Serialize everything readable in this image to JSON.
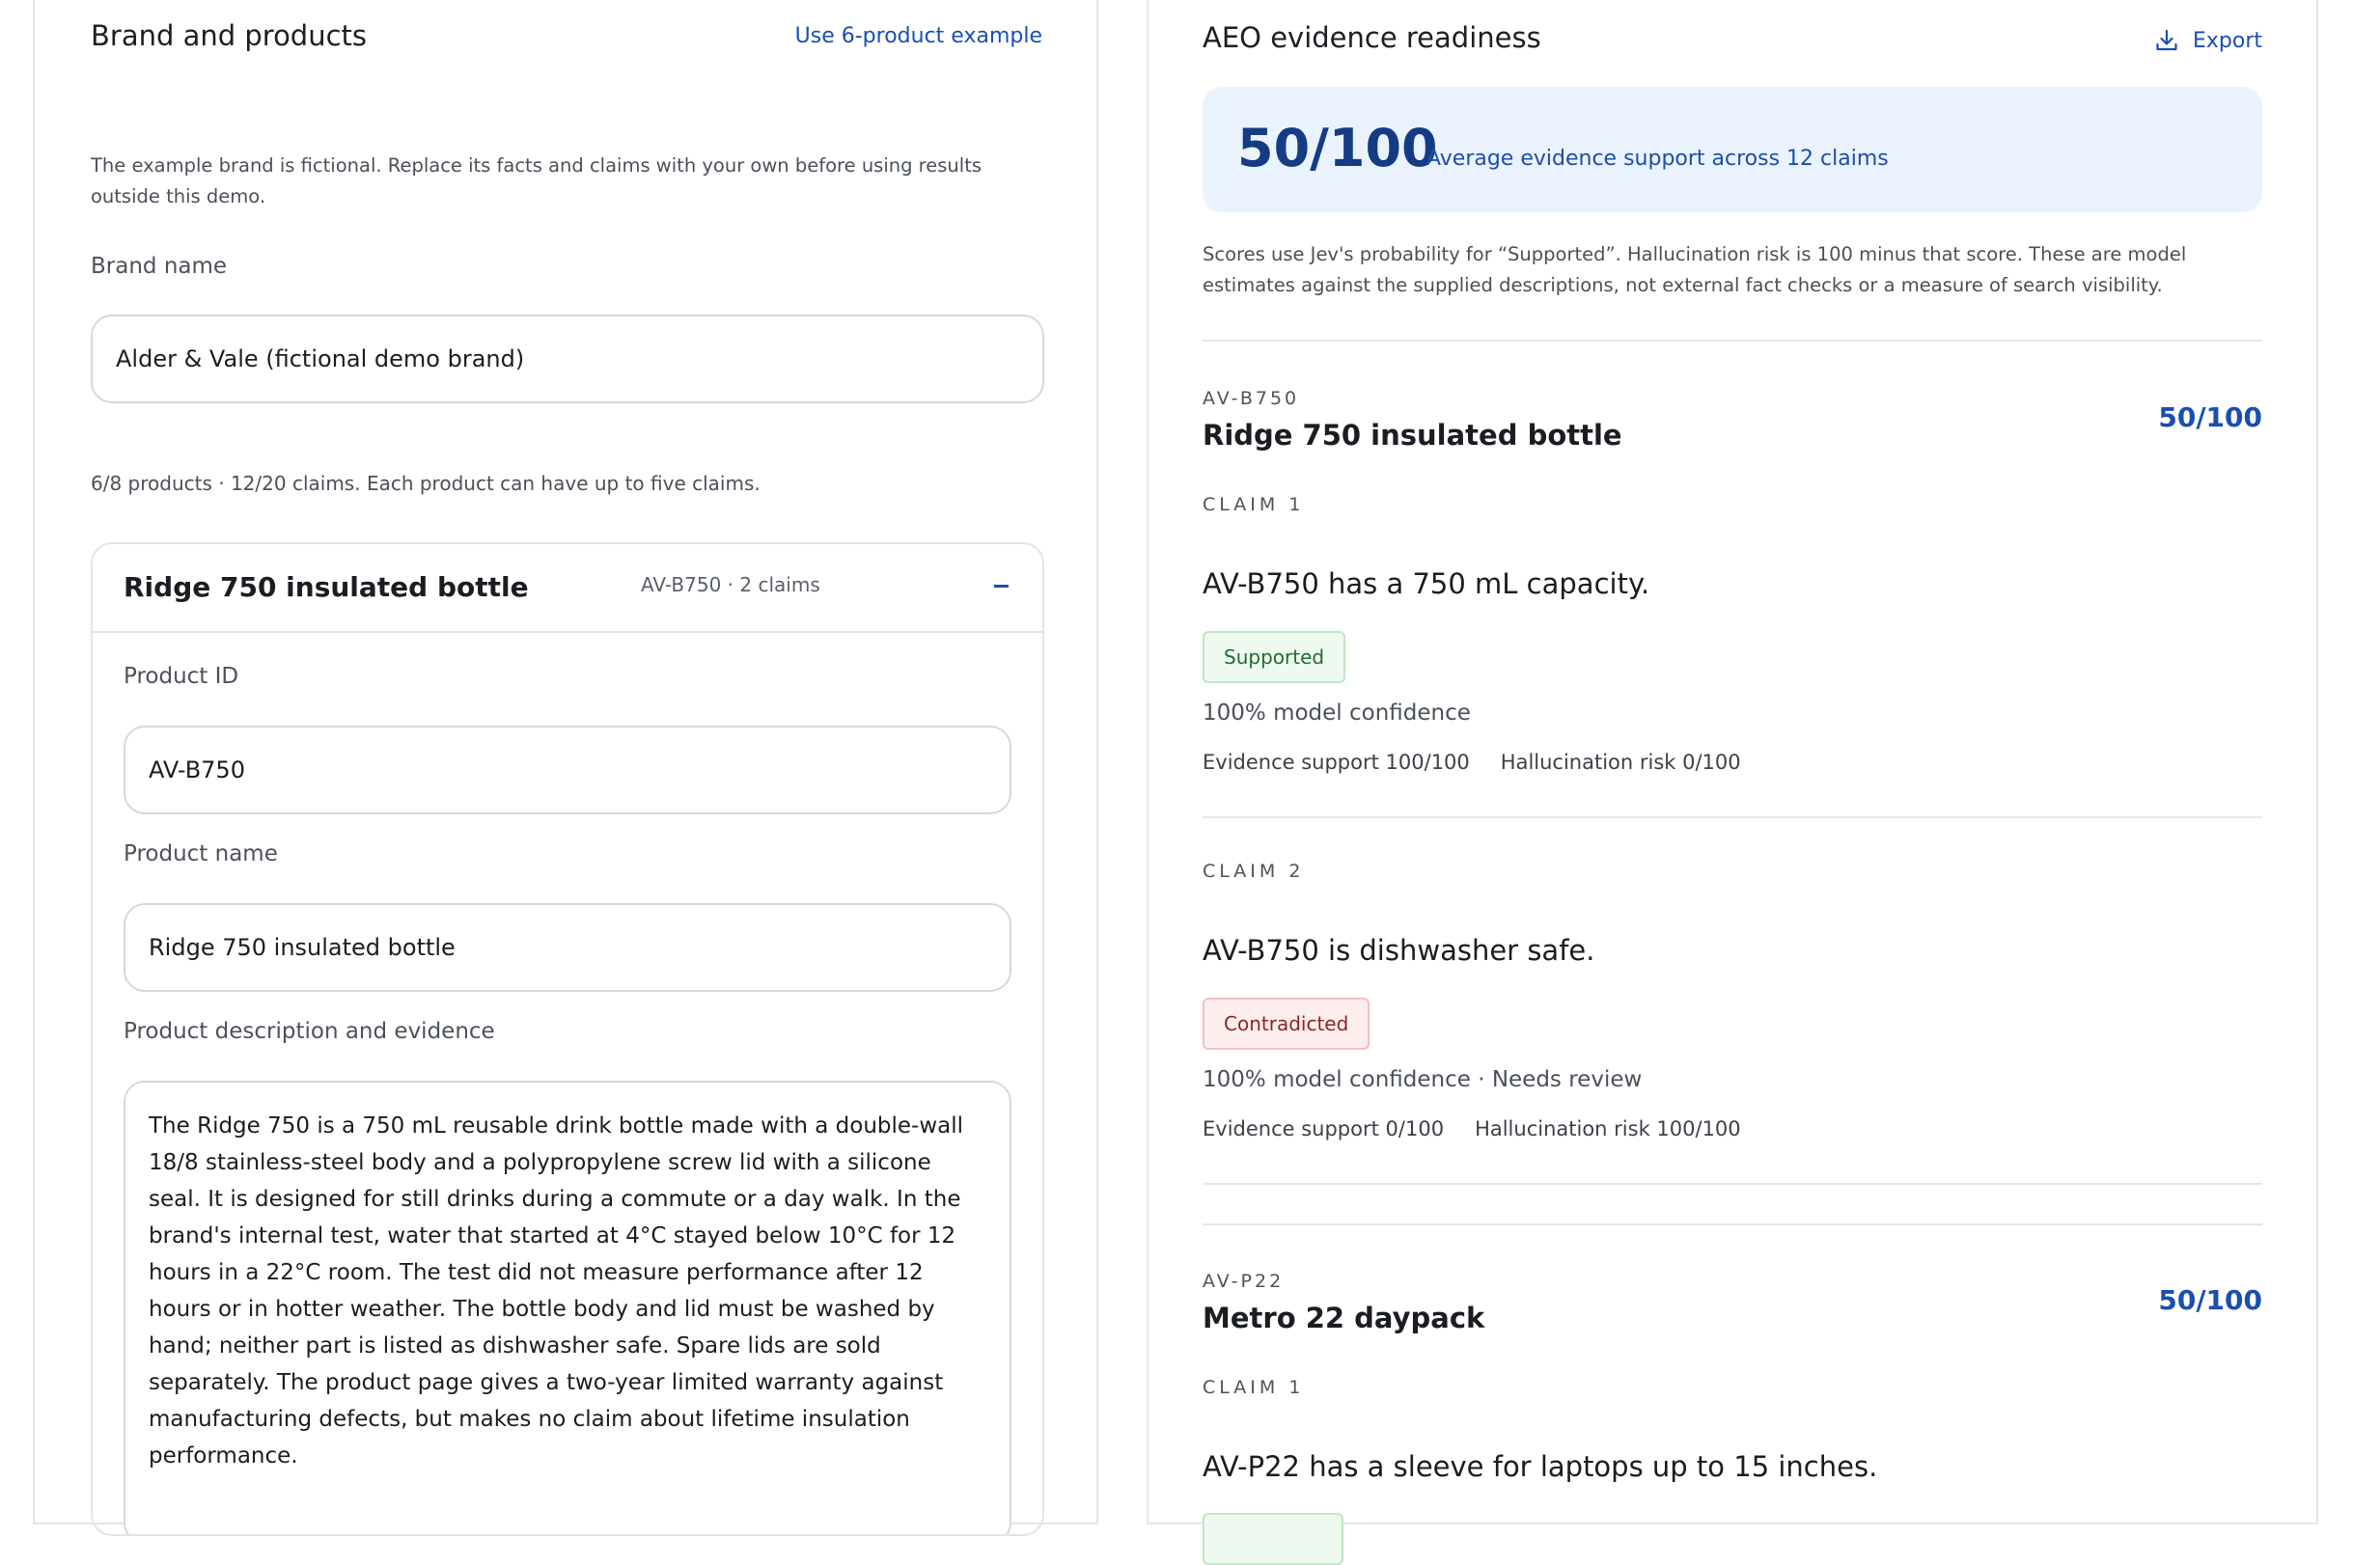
{
  "left": {
    "title": "Brand and products",
    "example_link": "Use 6-product example",
    "disclaimer": "The example brand is fictional. Replace its facts and claims with your own before using results outside this demo.",
    "brand_label": "Brand name",
    "brand_value": "Alder & Vale (fictional demo brand)",
    "counts": "6/8 products · 12/20 claims. Each product can have up to five claims.",
    "product_card": {
      "title": "Ridge 750 insulated bottle",
      "meta": "AV-B750 · 2 claims",
      "id_label": "Product ID",
      "id_value": "AV-B750",
      "name_label": "Product name",
      "name_value": "Ridge 750 insulated bottle",
      "desc_label": "Product description and evidence",
      "desc_value": "The Ridge 750 is a 750 mL reusable drink bottle made with a double-wall 18/8 stainless-steel body and a polypropylene screw lid with a silicone seal. It is designed for still drinks during a commute or a day walk. In the brand's internal test, water that started at 4°C stayed below 10°C for 12 hours in a 22°C room. The test did not measure performance after 12 hours or in hotter weather. The bottle body and lid must be washed by hand; neither part is listed as dishwasher safe. Spare lids are sold separately. The product page gives a two-year limited warranty against manufacturing defects, but makes no claim about lifetime insulation performance."
    }
  },
  "right": {
    "title": "AEO evidence readiness",
    "export_label": "Export",
    "export_icon": "download-icon",
    "score": "50/100",
    "score_desc": "Average evidence support across 12 claims",
    "note": "Scores use Jev's probability for “Supported”. Hallucination risk is 100 minus that score. These are model estimates against the supplied descriptions, not external fact checks or a measure of search visibility.",
    "products": [
      {
        "code": "AV-B750",
        "title": "Ridge 750 insulated bottle",
        "score": "50/100",
        "claims": [
          {
            "label": "CLAIM 1",
            "text": "AV-B750 has a 750 mL capacity.",
            "status": "Supported",
            "confidence": "100% model confidence",
            "support": "Evidence support 100/100",
            "risk": "Hallucination risk 0/100"
          },
          {
            "label": "CLAIM 2",
            "text": "AV-B750 is dishwasher safe.",
            "status": "Contradicted",
            "confidence": "100% model confidence · Needs review",
            "support": "Evidence support 0/100",
            "risk": "Hallucination risk 100/100"
          }
        ]
      },
      {
        "code": "AV-P22",
        "title": "Metro 22 daypack",
        "score": "50/100",
        "claims": [
          {
            "label": "CLAIM 1",
            "text": "AV-P22 has a sleeve for laptops up to 15 inches."
          }
        ]
      }
    ],
    "colors": {
      "accent": "#1a4fb0",
      "banner_bg": "#eaf2fd",
      "supported": "#236b31",
      "contradicted": "#8e2424"
    }
  }
}
